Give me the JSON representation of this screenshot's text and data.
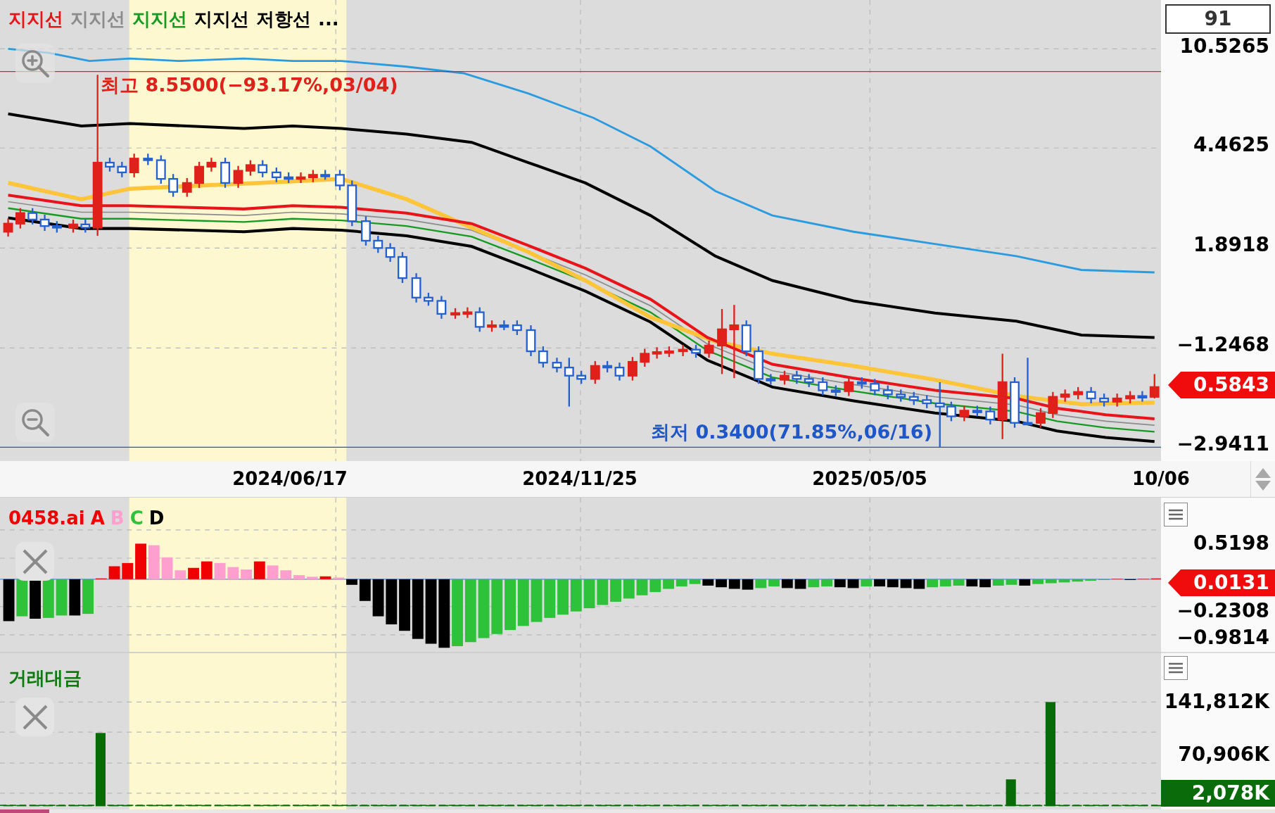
{
  "price_panel": {
    "legend": [
      {
        "label": "지지선",
        "color": "#e8141a"
      },
      {
        "label": "지지선",
        "color": "#8c8c8c"
      },
      {
        "label": "지지선",
        "color": "#159a22"
      },
      {
        "label": "지지선",
        "color": "#000000"
      },
      {
        "label": "저항선",
        "color": "#000000"
      }
    ],
    "legend_more": "...",
    "high_label": "최고 8.5500(−93.17%,03/04)",
    "low_label": "최저 0.3400(71.85%,06/16)",
    "period_box": "91",
    "axis_ticks": [
      "10.5265",
      "4.4625",
      "1.8918",
      "−1.2468",
      "−2.9411"
    ],
    "current_price": "0.5843"
  },
  "date_axis": {
    "labels": [
      "2024/06/17",
      "2024/11/25",
      "2025/05/05",
      "10/06"
    ]
  },
  "oscillator_panel": {
    "title": "0458.ai",
    "series": [
      {
        "label": "A",
        "color": "#f00000"
      },
      {
        "label": "B",
        "color": "#ff9fcf"
      },
      {
        "label": "C",
        "color": "#2ec13a"
      },
      {
        "label": "D",
        "color": "#000000"
      }
    ],
    "axis_ticks": [
      "0.5198",
      "−0.2308",
      "−0.9814"
    ],
    "current_value": "0.0131"
  },
  "volume_panel": {
    "title": "거래대금",
    "axis_ticks": [
      "141,812K",
      "70,906K"
    ],
    "current_value": "2,078K"
  }
}
